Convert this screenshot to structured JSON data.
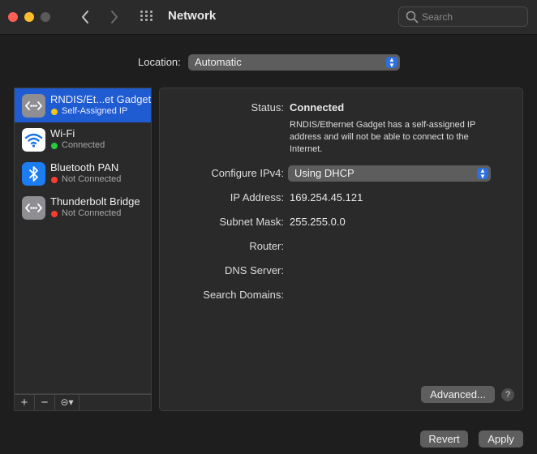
{
  "window": {
    "title": "Network"
  },
  "toolbar": {
    "back_glyph": "‹",
    "forward_glyph": "›",
    "search_placeholder": "Search"
  },
  "location": {
    "label": "Location:",
    "value": "Automatic"
  },
  "services": [
    {
      "name": "RNDIS/Et...et Gadget",
      "status": "Self-Assigned IP",
      "status_color": "#f5c518",
      "icon": "ethernet-icon",
      "selected": true
    },
    {
      "name": "Wi-Fi",
      "status": "Connected",
      "status_color": "#29c940",
      "icon": "wifi-icon",
      "selected": false
    },
    {
      "name": "Bluetooth PAN",
      "status": "Not Connected",
      "status_color": "#ff3b30",
      "icon": "bluetooth-icon",
      "selected": false
    },
    {
      "name": "Thunderbolt Bridge",
      "status": "Not Connected",
      "status_color": "#ff3b30",
      "icon": "thunderbolt-bridge-icon",
      "selected": false
    }
  ],
  "sidebar_toolbar": {
    "add": "+",
    "remove": "−",
    "action": "⊝▾"
  },
  "detail": {
    "status_label": "Status:",
    "status_value": "Connected",
    "status_description": "RNDIS/Ethernet Gadget has a self-assigned IP address and will not be able to connect to the Internet.",
    "configure_label": "Configure IPv4:",
    "configure_value": "Using DHCP",
    "ip_label": "IP Address:",
    "ip_value": "169.254.45.121",
    "subnet_label": "Subnet Mask:",
    "subnet_value": "255.255.0.0",
    "router_label": "Router:",
    "router_value": "",
    "dns_label": "DNS Server:",
    "dns_value": "",
    "search_domains_label": "Search Domains:",
    "search_domains_value": "",
    "advanced_label": "Advanced...",
    "help_label": "?"
  },
  "footer": {
    "revert_label": "Revert",
    "apply_label": "Apply"
  },
  "colors": {
    "selection": "#1f5bd1",
    "accent": "#2f6fdb"
  }
}
